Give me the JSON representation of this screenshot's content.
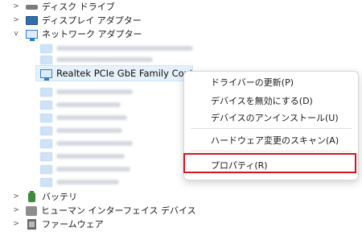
{
  "tree": {
    "disk_drives": "ディスク ドライブ",
    "display_adapters": "ディスプレイ アダプター",
    "network_adapters": "ネットワーク アダプター",
    "selected_device": "Realtek PCIe GbE Family Controll",
    "batteries": "バッテリ",
    "human_interface": "ヒューマン インターフェイス デバイス",
    "firmware": "ファームウェア"
  },
  "context_menu": {
    "items": [
      "ドライバーの更新(P)",
      "デバイスを無効にする(D)",
      "デバイスのアンインストール(U)",
      "ハードウェア変更のスキャン(A)",
      "プロパティ(R)"
    ]
  },
  "colors": {
    "highlight_border": "#d9141b",
    "selection_background": "#e6f1fb"
  }
}
